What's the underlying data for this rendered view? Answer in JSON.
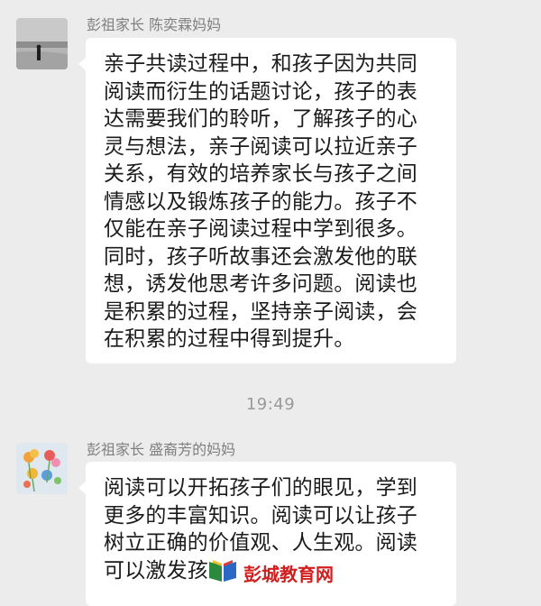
{
  "messages": [
    {
      "sender": "彭祖家长 陈奕霖妈妈",
      "avatar_icon": "beach-photo-avatar",
      "lines": [
        "亲子共读过程中，和孩子因为共同",
        "阅读而衍生的话题讨论，孩子的表",
        "达需要我们的聆听，了解孩子的心",
        "灵与想法，亲子阅读可以拉近亲子",
        "关系，有效的培养家长与孩子之间",
        "情感以及锻炼孩子的能力。孩子不",
        "仅能在亲子阅读过程中学到很多。",
        "同时，孩子听故事还会激发他的联",
        "想，诱发他思考许多问题。阅读也",
        "是积累的过程，坚持亲子阅读，会",
        "在积累的过程中得到提升。"
      ]
    },
    {
      "sender": "彭祖家长 盛裔芳的妈妈",
      "avatar_icon": "flower-painting-avatar",
      "lines": [
        "阅读可以开拓孩子们的眼见，学到",
        "更多的丰富知识。阅读可以让孩子",
        "树立正确的价值观、人生观。阅读",
        "可以激发孩"
      ]
    }
  ],
  "timestamp": "19:49",
  "watermark": {
    "text": "彭城教育网",
    "icon": "book-logo-icon"
  },
  "colors": {
    "background": "#ececec",
    "bubble": "#ffffff",
    "watermark": "#d11f1f"
  }
}
